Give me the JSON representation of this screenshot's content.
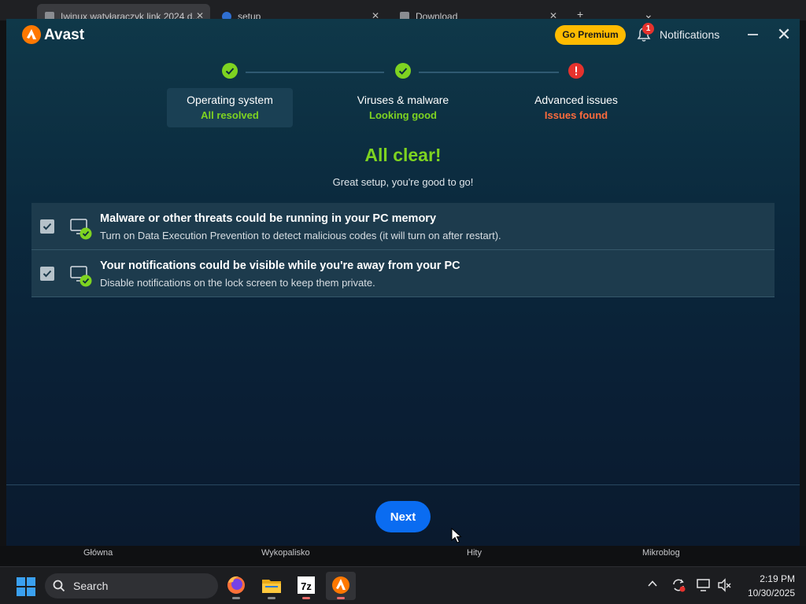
{
  "browser": {
    "tabs": [
      {
        "title": "Iwinux watyłaraczyk link 2024 d..."
      },
      {
        "title": "setup"
      },
      {
        "title": "Download"
      }
    ],
    "bottom_nav": [
      "Główna",
      "Wykopalisko",
      "Hity",
      "Mikroblog"
    ]
  },
  "app": {
    "name": "Avast",
    "go_premium": "Go Premium",
    "notifications_label": "Notifications",
    "notifications_count": "1",
    "close_symbol": "✕"
  },
  "steps": [
    {
      "title": "Operating system",
      "status": "All resolved",
      "state": "ok"
    },
    {
      "title": "Viruses & malware",
      "status": "Looking good",
      "state": "ok"
    },
    {
      "title": "Advanced issues",
      "status": "Issues found",
      "state": "error"
    }
  ],
  "headline": "All clear!",
  "subline": "Great setup, you're good to go!",
  "issues": [
    {
      "title": "Malware or other threats could be running in your PC memory",
      "description": "Turn on Data Execution Prevention to detect malicious codes (it will turn on after restart).",
      "checked": true
    },
    {
      "title": "Your notifications could be visible while you're away from your PC",
      "description": "Disable notifications on the lock screen to keep them private.",
      "checked": true
    }
  ],
  "next_label": "Next",
  "taskbar": {
    "search_label": "Search",
    "time": "2:19 PM",
    "date": "10/30/2025",
    "apps": [
      "firefox-icon",
      "file-explorer-icon",
      "7zip-icon",
      "avast-icon"
    ],
    "sevenzip_label": "7z"
  },
  "colors": {
    "accent_green": "#7ed321",
    "issue_orange": "#ff6b3c",
    "premium_yellow": "#ffbb00",
    "next_blue": "#0a6cf1",
    "avast_orange": "#ff7800"
  }
}
